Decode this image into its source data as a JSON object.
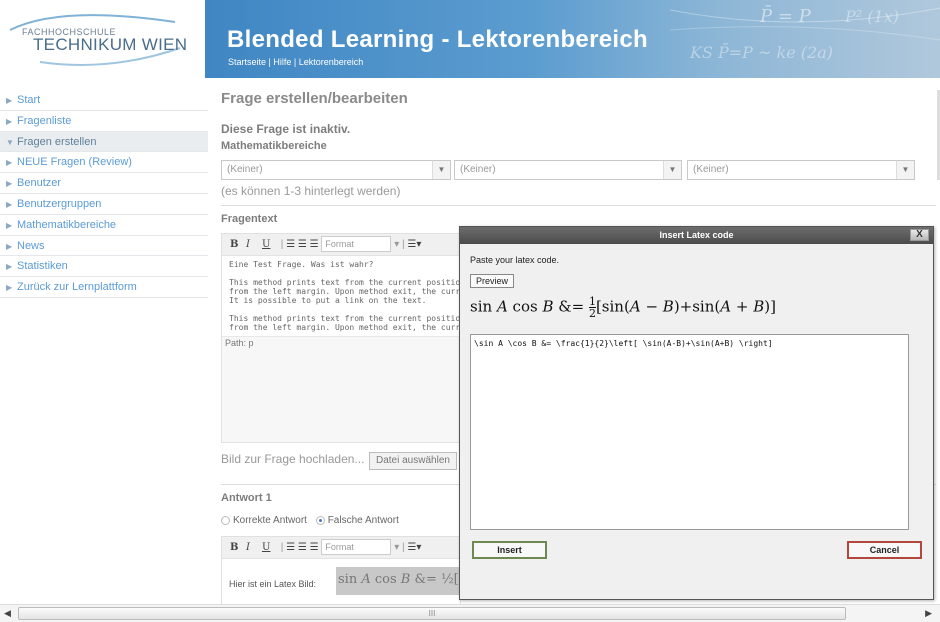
{
  "header": {
    "logo_line1": "FACHHOCHSCHULE",
    "logo_line2": "TECHNIKUM WIEN",
    "title": "Blended Learning - Lektorenbereich",
    "nav": [
      "Startseite",
      "Hilfe",
      "Lektorenbereich"
    ],
    "nav_separator": "|"
  },
  "sidebar": {
    "items": [
      {
        "label": "Start",
        "active": false
      },
      {
        "label": "Fragenliste",
        "active": false
      },
      {
        "label": "Fragen erstellen",
        "active": true
      },
      {
        "label": "NEUE Fragen (Review)",
        "active": false
      },
      {
        "label": "Benutzer",
        "active": false
      },
      {
        "label": "Benutzergruppen",
        "active": false
      },
      {
        "label": "Mathematikbereiche",
        "active": false
      },
      {
        "label": "News",
        "active": false
      },
      {
        "label": "Statistiken",
        "active": false
      },
      {
        "label": "Zurück zur Lernplattform",
        "active": false
      }
    ]
  },
  "main": {
    "page_title": "Frage erstellen/bearbeiten",
    "inactive_notice": "Diese Frage ist inaktiv.",
    "math_areas_label": "Mathematikbereiche",
    "selects": [
      "(Keiner)",
      "(Keiner)",
      "(Keiner)"
    ],
    "selects_hint": "(es können 1-3 hinterlegt werden)",
    "question_text_label": "Fragentext",
    "editor": {
      "format_placeholder": "Format",
      "lines": [
        "Eine Test Frage. Was ist wahr?",
        "",
        "This method prints text from the current position.",
        "from the left margin. Upon method exit, the curre",
        "It is possible to put a link on the text.",
        "",
        "This method prints text from the current position.",
        "from the left margin. Upon method exit, the curre"
      ],
      "path": "Path: p"
    },
    "upload_label": "Bild zur Frage hochladen...",
    "file_button": "Datei auswählen",
    "answer_label": "Antwort 1",
    "radio_correct": "Korrekte Antwort",
    "radio_wrong": "Falsche Antwort",
    "answer_editor_text": "Hier ist ein Latex Bild:"
  },
  "modal": {
    "title": "Insert Latex code",
    "close_label": "X",
    "instruction": "Paste your latex code.",
    "preview_button": "Preview",
    "latex_code": "\\sin A \\cos B &= \\frac{1}{2}\\left[ \\sin(A-B)+\\sin(A+B) \\right]",
    "insert_button": "Insert",
    "cancel_button": "Cancel"
  },
  "scrollbar": {
    "thumb_grip": "III"
  }
}
